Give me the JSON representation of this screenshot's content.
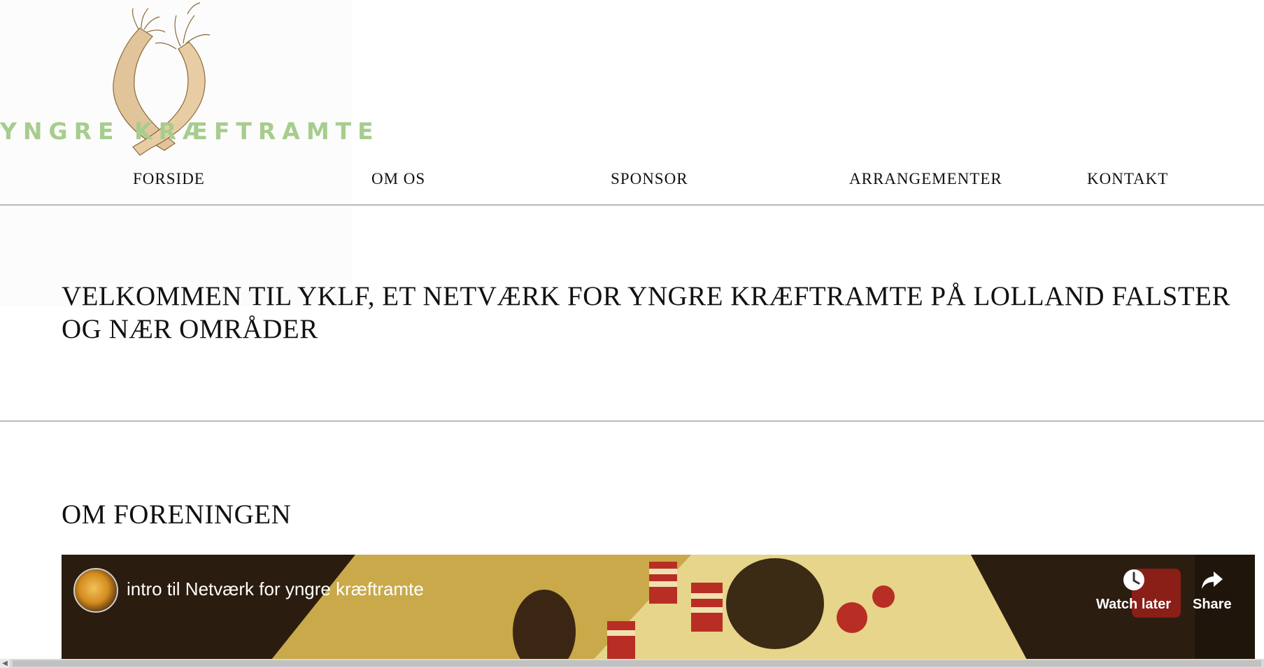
{
  "logo": {
    "text": "YNGRE KRÆFTRAMTE",
    "colors": {
      "text": "#a6cd8d",
      "arms": "#e2c49a",
      "outline": "#8a6a3a"
    }
  },
  "nav": {
    "items": [
      {
        "label": "FORSIDE"
      },
      {
        "label": "OM OS"
      },
      {
        "label": "SPONSOR"
      },
      {
        "label": "ARRANGEMENTER"
      },
      {
        "label": "KONTAKT"
      }
    ]
  },
  "headline": "VELKOMMEN TIL YKLF, ET NETVÆRK FOR YNGRE KRÆFTRAMTE PÅ LOLLAND FALSTER OG NÆR OMRÅDER",
  "section": {
    "title": "OM FORENINGEN"
  },
  "video": {
    "title": "intro til Netværk for yngre kræftramte",
    "watch_later_label": "Watch later",
    "share_label": "Share",
    "icons": {
      "watch_later": "clock-icon",
      "share": "share-arrow-icon"
    }
  },
  "scrollbar": {
    "direction": "horizontal"
  }
}
